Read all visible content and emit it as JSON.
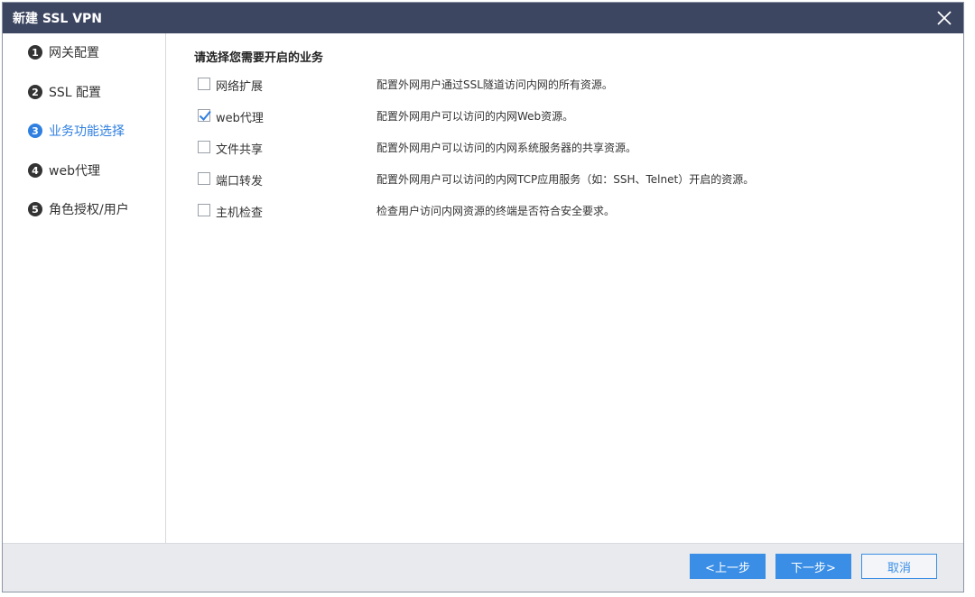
{
  "dialog": {
    "title": "新建 SSL VPN"
  },
  "steps": [
    {
      "num": "1",
      "label": "网关配置"
    },
    {
      "num": "2",
      "label": "SSL 配置"
    },
    {
      "num": "3",
      "label": "业务功能选择",
      "active": true
    },
    {
      "num": "4",
      "label": "web代理"
    },
    {
      "num": "5",
      "label": "角色授权/用户"
    }
  ],
  "main": {
    "heading": "请选择您需要开启的业务",
    "services": [
      {
        "label": "网络扩展",
        "checked": false,
        "desc": "配置外网用户通过SSL隧道访问内网的所有资源。"
      },
      {
        "label": "web代理",
        "checked": true,
        "desc": "配置外网用户可以访问的内网Web资源。"
      },
      {
        "label": "文件共享",
        "checked": false,
        "desc": "配置外网用户可以访问的内网系统服务器的共享资源。"
      },
      {
        "label": "端口转发",
        "checked": false,
        "desc": "配置外网用户可以访问的内网TCP应用服务（如：SSH、Telnet）开启的资源。"
      },
      {
        "label": "主机检查",
        "checked": false,
        "desc": "检查用户访问内网资源的终端是否符合安全要求。"
      }
    ]
  },
  "footer": {
    "prev_label": "<上一步",
    "next_label": "下一步>",
    "cancel_label": "取消"
  },
  "icons": {
    "close": "close-icon",
    "check": "checkmark-icon"
  },
  "colors": {
    "titlebar": "#3d4660",
    "accent": "#3a8ee6",
    "active_step": "#2f7fe0"
  }
}
